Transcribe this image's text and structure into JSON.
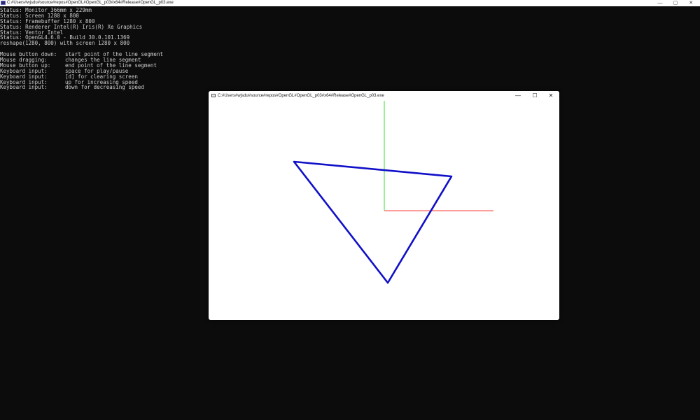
{
  "console": {
    "title": "C:#Users#wjsdu#source#repos#OpenGL#OpenGL_p03#x64#Release#OpenGL_p03.exe",
    "window_controls": {
      "minimize": "—",
      "maximize": "▢",
      "close": "✕"
    },
    "status_lines": [
      "Status: Monitor 366mm x 229mm",
      "Status: Screen 1280 x 800",
      "Status: Framebuffer 1280 x 800",
      "Status: Renderer Intel(R) Iris(R) Xe Graphics",
      "Status: Ventor Intel",
      "Status: OpenGL4.6.0 - Build 30.0.101.1369",
      "reshape(1280, 800) with screen 1280 x 800"
    ],
    "help_lines": [
      {
        "key": "Mouse button down:",
        "value": "start point of the line segment"
      },
      {
        "key": "Mouse dragging:",
        "value": "changes the line segment"
      },
      {
        "key": "Mouse button up:",
        "value": "end point of the line segment"
      },
      {
        "key": "Keyboard input:",
        "value": "space for play/pause"
      },
      {
        "key": "Keyboard input:",
        "value": "[d] for clearing screen"
      },
      {
        "key": "Keyboard input:",
        "value": "up for increasing speed"
      },
      {
        "key": "Keyboard input:",
        "value": "down for decreasing speed"
      }
    ]
  },
  "gl_window": {
    "title": "C:#Users#wjsdu#source#repos#OpenGL#OpenGL_p03#x64#Release#OpenGL_p03.exe",
    "window_controls": {
      "minimize": "—",
      "maximize": "☐",
      "close": "✕"
    },
    "colors": {
      "background": "#ffffff",
      "x_axis": "#ff3b3b",
      "y_axis": "#3ddc3d",
      "triangle": "#1010c8"
    }
  }
}
